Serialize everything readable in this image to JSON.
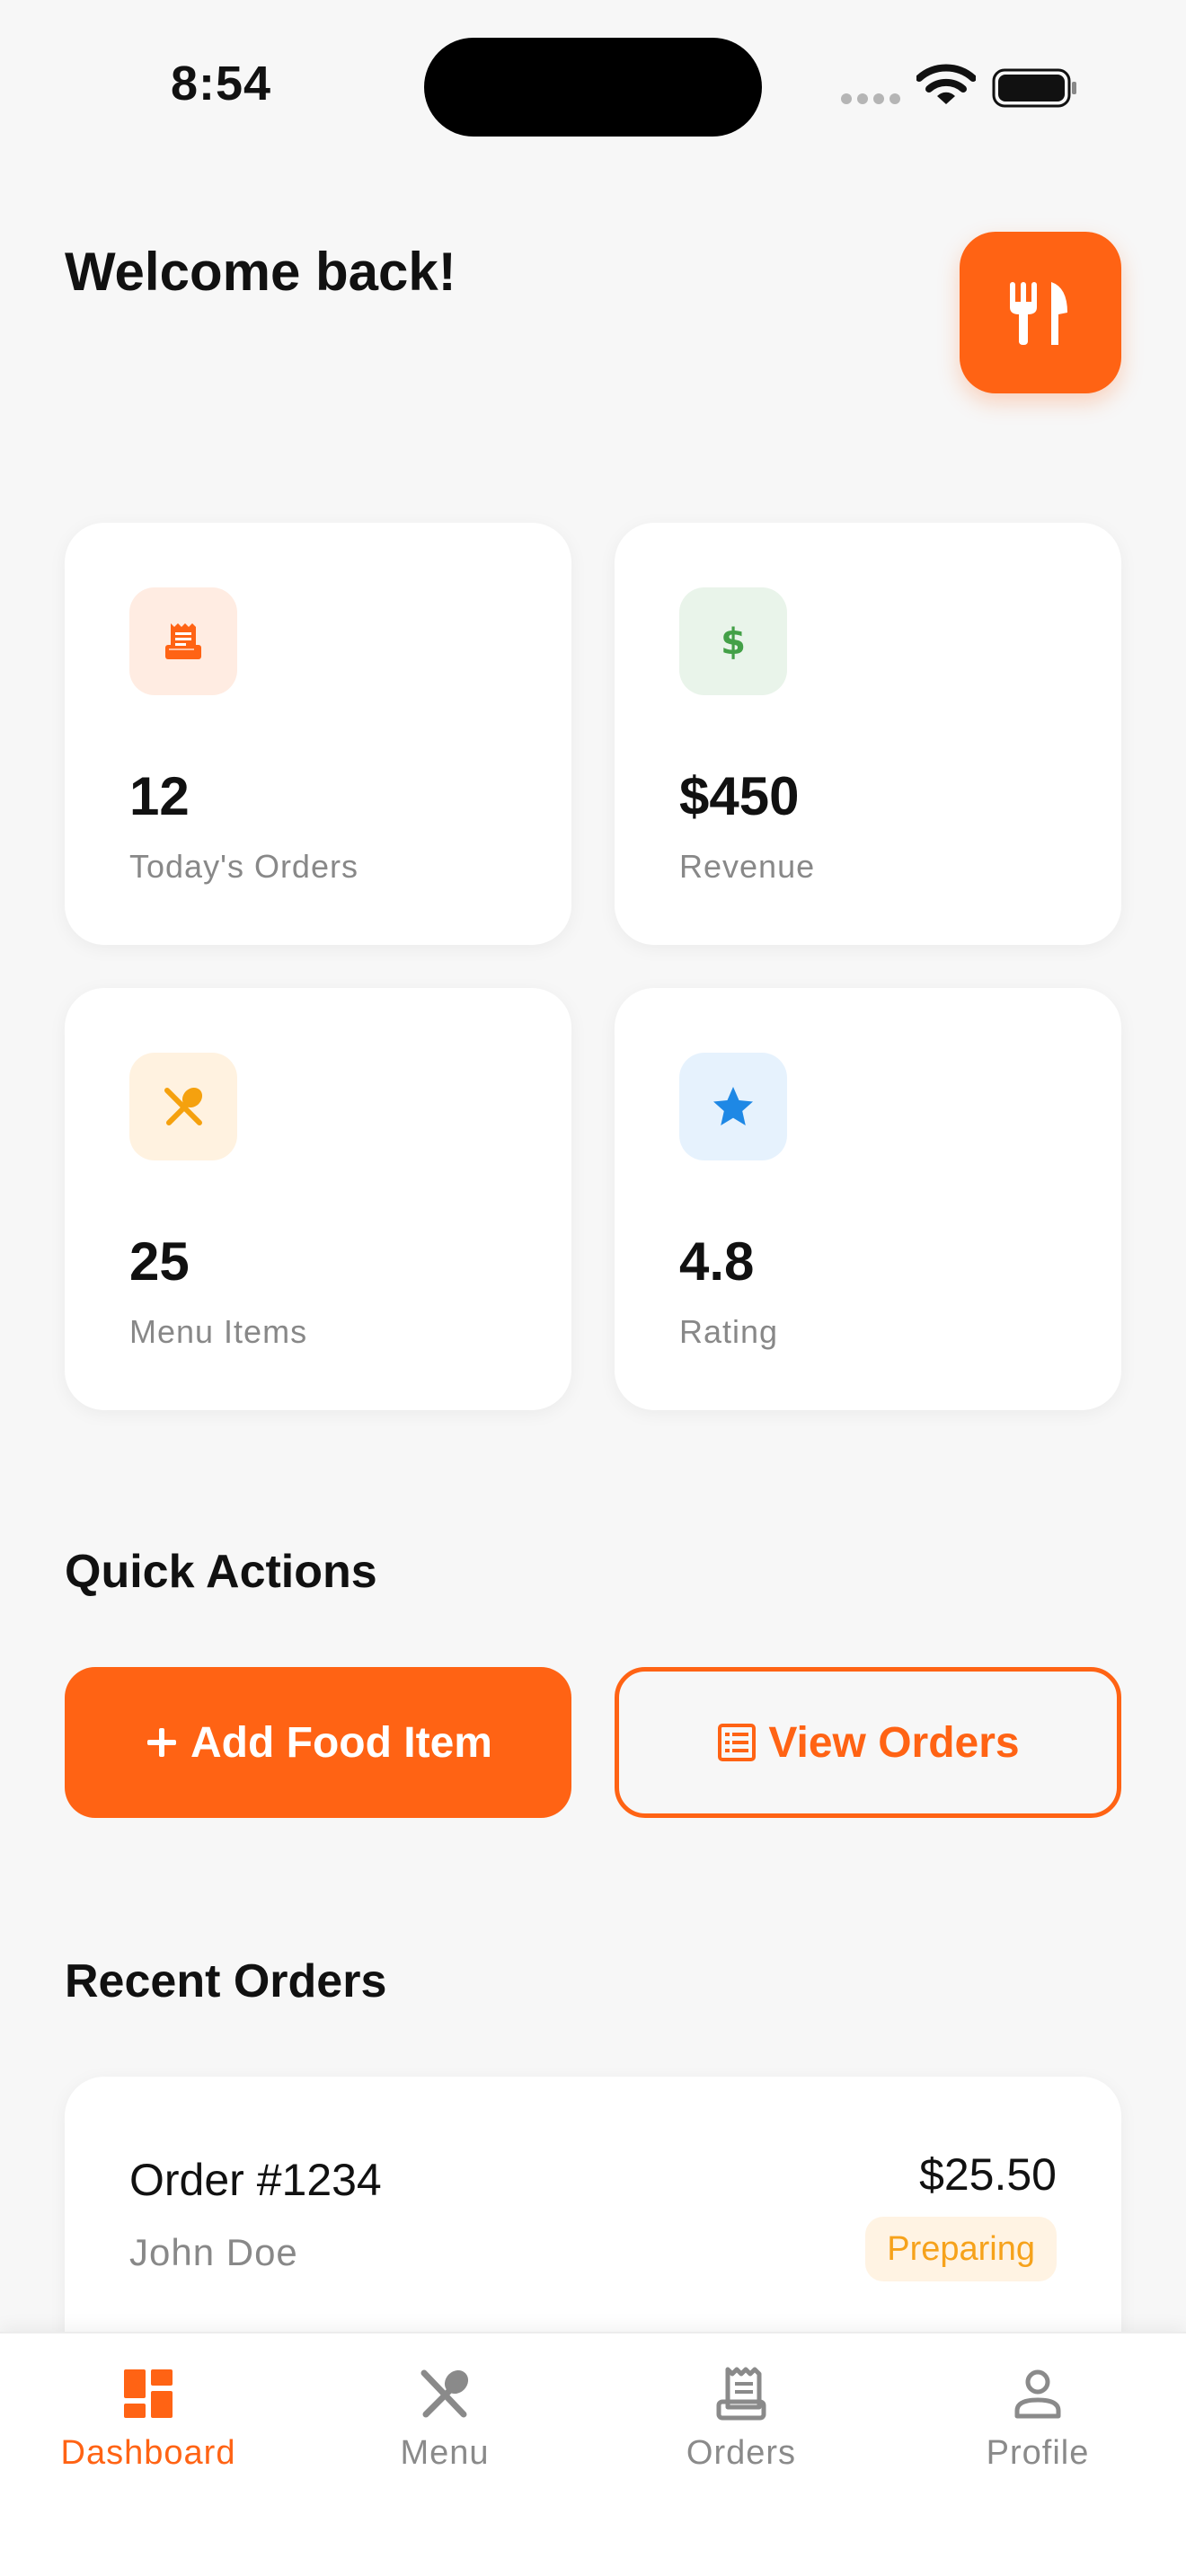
{
  "status_bar": {
    "time": "8:54"
  },
  "header": {
    "welcome": "Welcome back!",
    "logo_icon": "fork-knife-icon"
  },
  "stats": [
    {
      "value": "12",
      "label": "Today's Orders",
      "icon": "receipt-icon",
      "color": "#ff6314",
      "bg": "#ffece2"
    },
    {
      "value": "$450",
      "label": "Revenue",
      "icon": "dollar-icon",
      "color": "#43a047",
      "bg": "#e9f4ea"
    },
    {
      "value": "25",
      "label": "Menu Items",
      "icon": "utensils-icon",
      "color": "#f5a10e",
      "bg": "#fff2e0"
    },
    {
      "value": "4.8",
      "label": "Rating",
      "icon": "star-icon",
      "color": "#1e88e5",
      "bg": "#e6f2fd"
    }
  ],
  "quick_actions": {
    "title": "Quick Actions",
    "add_food": {
      "label": "Add Food Item",
      "icon": "plus-icon"
    },
    "view_orders": {
      "label": "View Orders",
      "icon": "list-icon"
    }
  },
  "recent_orders": {
    "title": "Recent Orders",
    "items": [
      {
        "id": "Order #1234",
        "customer": "John Doe",
        "total": "$25.50",
        "status": "Preparing"
      }
    ]
  },
  "bottom_nav": [
    {
      "label": "Dashboard",
      "icon": "dashboard-icon",
      "active": true
    },
    {
      "label": "Menu",
      "icon": "menu-utensils-icon",
      "active": false
    },
    {
      "label": "Orders",
      "icon": "receipt-icon",
      "active": false
    },
    {
      "label": "Profile",
      "icon": "person-icon",
      "active": false
    }
  ],
  "colors": {
    "accent": "#ff6314",
    "background": "#f7f7f7",
    "muted_text": "#888888"
  }
}
